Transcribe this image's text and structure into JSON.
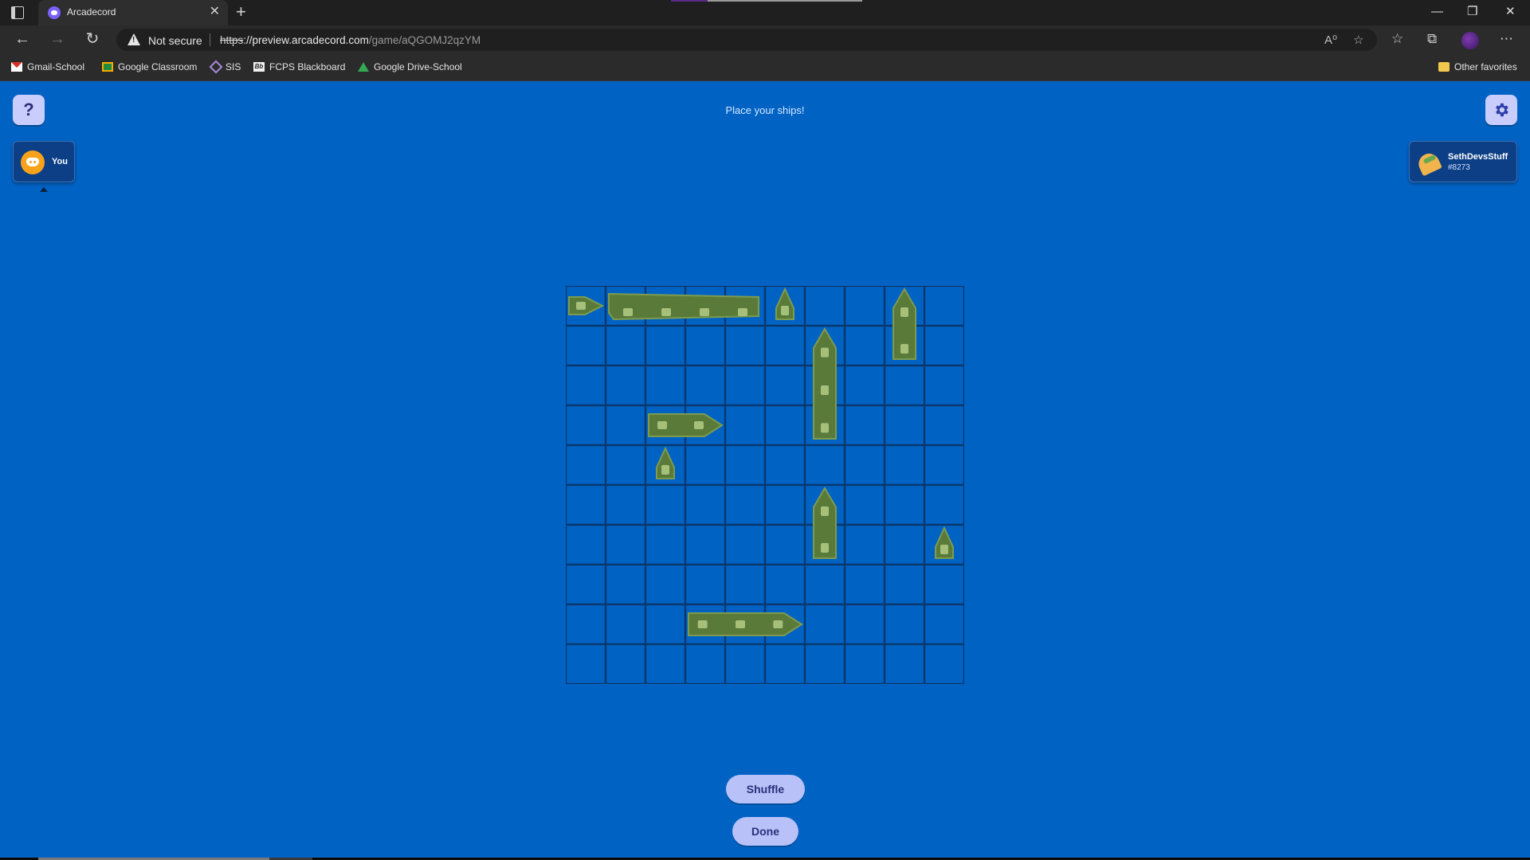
{
  "browser": {
    "tab_title": "Arcadecord",
    "tab_close": "✕",
    "new_tab": "+",
    "window_controls": [
      "—",
      "❐",
      "✕"
    ],
    "nav": {
      "back": "←",
      "forward": "→",
      "reload": "↻"
    },
    "security_label": "Not secure",
    "url": {
      "scheme": "https",
      "host": "://preview.arcadecord.com",
      "path": "/game/aQGOMJ2qzYM"
    },
    "omnibox_icons": [
      "A⁰",
      "☆"
    ],
    "toolbar_icons": [
      "☆",
      "⧉",
      "⋯"
    ],
    "bookmarks": [
      {
        "label": "Gmail-School",
        "icon": "gmail-icon"
      },
      {
        "label": "Google Classroom",
        "icon": "classroom-icon"
      },
      {
        "label": "SIS",
        "icon": "sis-icon"
      },
      {
        "label": "FCPS Blackboard",
        "icon": "blackboard-icon"
      },
      {
        "label": "Google Drive-School",
        "icon": "drive-icon"
      }
    ],
    "other_favorites": "Other favorites"
  },
  "game": {
    "status": "Place your ships!",
    "help_label": "?",
    "player_you": {
      "name": "You",
      "avatar": "discord-icon"
    },
    "player_opponent": {
      "name": "SethDevsStuff",
      "tag": "#8273",
      "avatar": "taco-icon"
    },
    "board": {
      "rows": 10,
      "cols": 10,
      "ships": [
        {
          "name": "patrol-boat",
          "col": 0,
          "row": 0,
          "length": 1,
          "orientation": "horizontal",
          "kind": "small"
        },
        {
          "name": "carrier",
          "col": 1,
          "row": 0,
          "length": 4,
          "orientation": "horizontal",
          "kind": "carrier"
        },
        {
          "name": "patrol-boat",
          "col": 5,
          "row": 0,
          "length": 1,
          "orientation": "vertical",
          "kind": "small"
        },
        {
          "name": "destroyer",
          "col": 8,
          "row": 0,
          "length": 2,
          "orientation": "vertical",
          "kind": "medium"
        },
        {
          "name": "battleship",
          "col": 6,
          "row": 1,
          "length": 3,
          "orientation": "vertical",
          "kind": "large"
        },
        {
          "name": "destroyer",
          "col": 2,
          "row": 3,
          "length": 2,
          "orientation": "horizontal",
          "kind": "medium"
        },
        {
          "name": "patrol-boat",
          "col": 2,
          "row": 4,
          "length": 1,
          "orientation": "vertical",
          "kind": "small"
        },
        {
          "name": "destroyer",
          "col": 6,
          "row": 5,
          "length": 2,
          "orientation": "vertical",
          "kind": "medium"
        },
        {
          "name": "patrol-boat",
          "col": 9,
          "row": 6,
          "length": 1,
          "orientation": "vertical",
          "kind": "small"
        },
        {
          "name": "battleship",
          "col": 3,
          "row": 8,
          "length": 3,
          "orientation": "horizontal",
          "kind": "large"
        }
      ],
      "colors": {
        "water": "#0063c4",
        "grid": "#08386f",
        "ship": "#5a7a3a",
        "ship_edge": "#7d9b4e",
        "ship_detail": "#a6c07a"
      }
    },
    "shuffle_label": "Shuffle",
    "done_label": "Done"
  },
  "colors": {
    "background": "#0063c4",
    "button": "#b8c1f8",
    "button_text": "#2b2f7a"
  }
}
